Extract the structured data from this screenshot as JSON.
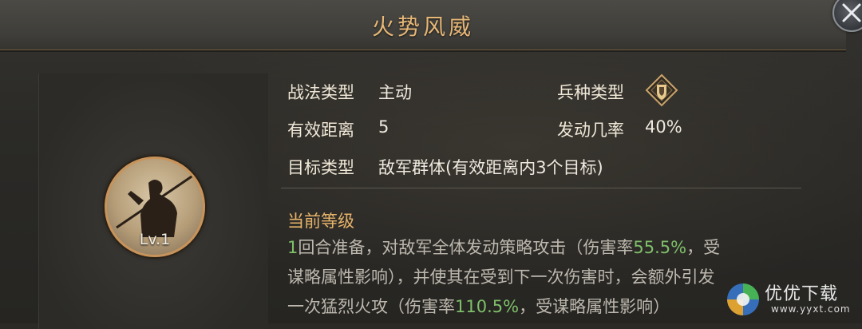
{
  "header": {
    "title": "火势风威"
  },
  "skill": {
    "level": "Lv.1",
    "attributes": [
      {
        "label": "战法类型",
        "value": "主动"
      },
      {
        "label": "有效距离",
        "value": "5"
      },
      {
        "label": "目标类型",
        "value": "敌军群体(有效距离内3个目标)"
      },
      {
        "label": "兵种类型",
        "value": "",
        "icon": "troop-type-icon"
      },
      {
        "label": "发动几率",
        "value": "40%"
      }
    ],
    "section_title": "当前等级",
    "description": {
      "l1_a": "1",
      "l1_b": "回合准备，对敌军全体发动策略攻击（伤害率",
      "l1_c": "55.5%",
      "l1_d": "，受",
      "l2": "谋略属性影响），并使其在受到下一次伤害时，会额外引发",
      "l3_a": "一次猛烈火攻（伤害率",
      "l3_b": "110.5%",
      "l3_c": "，受谋略属性影响）"
    }
  },
  "colors": {
    "title": "#e6b777",
    "highlight": "#7fbf6a",
    "section": "#e6b36a",
    "frame": "#c7935a"
  },
  "watermark": {
    "text": "优优下载",
    "url": "www.yyxt.com"
  }
}
